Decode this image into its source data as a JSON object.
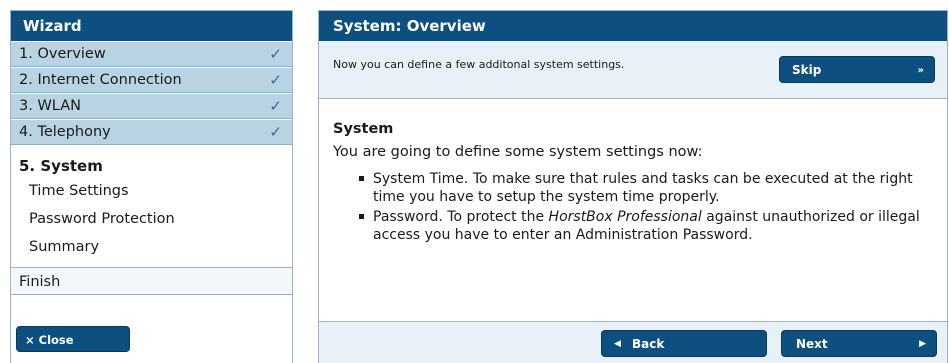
{
  "wizard": {
    "title": "Wizard",
    "steps": [
      {
        "label": "1. Overview",
        "check": "✓"
      },
      {
        "label": "2. Internet Connection",
        "check": "✓"
      },
      {
        "label": "3. WLAN",
        "check": "✓"
      },
      {
        "label": "4. Telephony",
        "check": "✓"
      }
    ],
    "current": {
      "label": "5. System",
      "substeps": [
        "Time Settings",
        "Password Protection",
        "Summary"
      ]
    },
    "finish": "Finish",
    "close_label": "× Close"
  },
  "panel": {
    "title": "System: Overview",
    "intro": "Now you can define a few additonal system settings.",
    "skip_label": "Skip",
    "skip_icon": "»",
    "heading": "System",
    "lead": "You are going to define some system settings now:",
    "bullets": [
      {
        "text": "System Time. To make sure that rules and tasks can be executed at the right time you have to setup the system time properly."
      },
      {
        "pre": "Password. To protect the ",
        "em": "HorstBox Professional",
        "post": " against unauthorized or illegal access you have to enter an Administration Password."
      }
    ],
    "back_label": "Back",
    "back_icon": "◀",
    "next_label": "Next",
    "next_icon": "▶"
  },
  "colors": {
    "header": "#0d4f7f",
    "step_bg": "#b9d3e3",
    "check": "#2a6fa8",
    "panel_bg": "#e8f1f8"
  }
}
